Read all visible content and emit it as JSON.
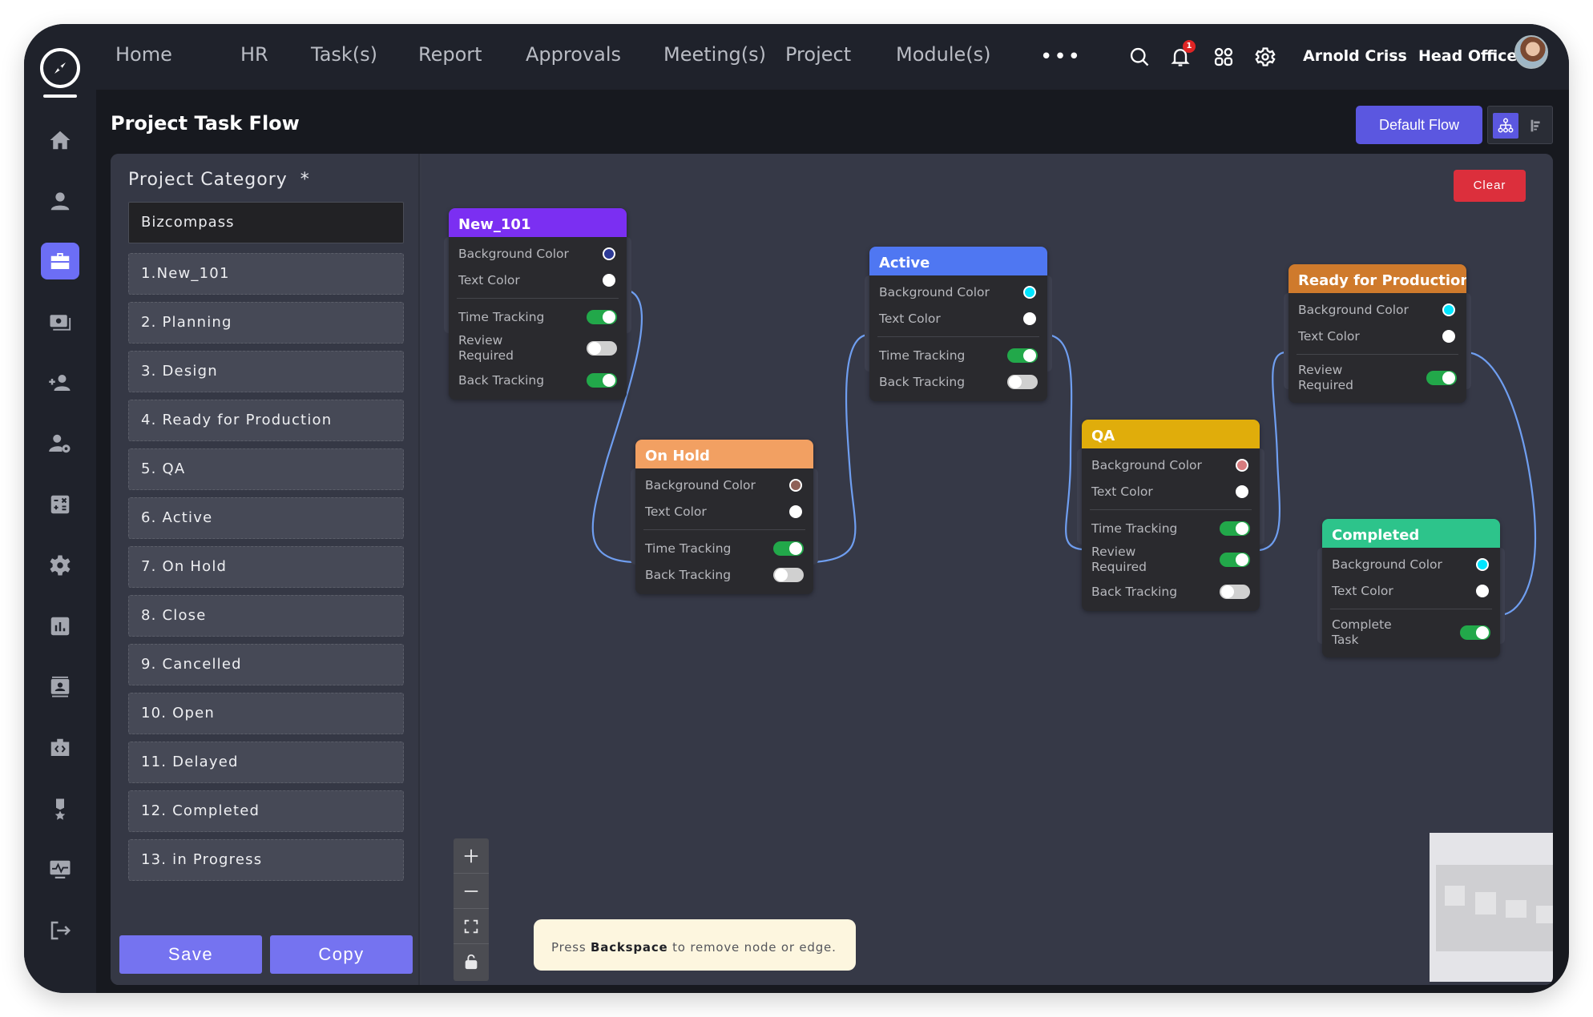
{
  "topnav": {
    "items": [
      "Home",
      "HR",
      "Task(s)",
      "Report",
      "Approvals",
      "Meeting(s)",
      "Project",
      "Module(s)"
    ],
    "more_icon": "more-horizontal-icon",
    "notification_count": "1",
    "user_name": "Arnold Criss",
    "branch": "Head Office",
    "icons": [
      "search-icon",
      "bell-icon",
      "apps-grid-icon",
      "gear-icon"
    ]
  },
  "sidebar": {
    "logo_icon": "compass-icon",
    "items": [
      {
        "icon": "home-icon",
        "active": false
      },
      {
        "icon": "user-icon",
        "active": false
      },
      {
        "icon": "briefcase-icon",
        "active": true
      },
      {
        "icon": "money-icon",
        "active": false
      },
      {
        "icon": "add-user-icon",
        "active": false
      },
      {
        "icon": "user-settings-icon",
        "active": false
      },
      {
        "icon": "calculator-icon",
        "active": false
      },
      {
        "icon": "gear-icon",
        "active": false
      },
      {
        "icon": "bar-chart-icon",
        "active": false
      },
      {
        "icon": "contact-card-icon",
        "active": false
      },
      {
        "icon": "code-briefcase-icon",
        "active": false
      },
      {
        "icon": "medal-icon",
        "active": false
      },
      {
        "icon": "monitor-pulse-icon",
        "active": false
      },
      {
        "icon": "logout-icon",
        "active": false
      }
    ]
  },
  "page": {
    "title": "Project Task Flow",
    "default_flow_label": "Default Flow",
    "view_toggle": [
      "flow-view-icon",
      "list-view-icon"
    ]
  },
  "category_panel": {
    "label": "Project Category",
    "required_mark": "*",
    "selected": "Bizcompass",
    "items": [
      "1.New_101",
      "2. Planning",
      "3. Design",
      "4. Ready for Production",
      "5. QA",
      "6. Active",
      "7. On Hold",
      "8. Close",
      "9. Cancelled",
      "10. Open",
      "11. Delayed",
      "12. Completed",
      "13. in Progress"
    ],
    "save_label": "Save",
    "copy_label": "Copy"
  },
  "canvas": {
    "clear_label": "Clear",
    "hint": {
      "prefix": "Press ",
      "key": "Backspace",
      "suffix": " to remove node or edge."
    },
    "controls": [
      "zoom-in-icon",
      "zoom-out-icon",
      "fit-view-icon",
      "lock-icon"
    ],
    "nodes": [
      {
        "id": "new101",
        "title": "New_101",
        "header_color": "#7b2ff2",
        "bg_color_swatch": "#2d3a96",
        "text_color_swatch": "#ffffff",
        "bg_label": "Background Color",
        "text_label": "Text Color",
        "toggles": [
          {
            "label": "Time Tracking",
            "on": true
          },
          {
            "label": "Review Required",
            "on": false
          },
          {
            "label": "Back Tracking",
            "on": true
          }
        ]
      },
      {
        "id": "onhold",
        "title": "On Hold",
        "header_color": "#f2a062",
        "bg_color_swatch": "#8f6158",
        "text_color_swatch": "#ffffff",
        "bg_label": "Background Color",
        "text_label": "Text Color",
        "toggles": [
          {
            "label": "Time Tracking",
            "on": true
          },
          {
            "label": "Back Tracking",
            "on": false
          }
        ]
      },
      {
        "id": "active",
        "title": "Active",
        "header_color": "#4f77f2",
        "bg_color_swatch": "#00e5ff",
        "text_color_swatch": "#ffffff",
        "bg_label": "Background Color",
        "text_label": "Text Color",
        "toggles": [
          {
            "label": "Time Tracking",
            "on": true
          },
          {
            "label": "Back Tracking",
            "on": false
          }
        ]
      },
      {
        "id": "qa",
        "title": "QA",
        "header_color": "#e0ad0b",
        "bg_color_swatch": "#d77b7e",
        "text_color_swatch": "#ffffff",
        "bg_label": "Background Color",
        "text_label": "Text Color",
        "toggles": [
          {
            "label": "Time Tracking",
            "on": true
          },
          {
            "label": "Review Required",
            "on": true
          },
          {
            "label": "Back Tracking",
            "on": false
          }
        ]
      },
      {
        "id": "ready",
        "title": "Ready for Production",
        "header_color": "#cf7a2c",
        "bg_color_swatch": "#00e5ff",
        "text_color_swatch": "#ffffff",
        "bg_label": "Background Color",
        "text_label": "Text Color",
        "toggles": [
          {
            "label": "Review Required",
            "on": true
          }
        ]
      },
      {
        "id": "completed",
        "title": "Completed",
        "header_color": "#2dc48b",
        "bg_color_swatch": "#00e5ff",
        "text_color_swatch": "#ffffff",
        "bg_label": "Background Color",
        "text_label": "Text Color",
        "toggles": [
          {
            "label": "Complete Task",
            "on": true
          }
        ]
      }
    ],
    "edges": [
      {
        "from": "New_101",
        "to": "On Hold"
      },
      {
        "from": "On Hold",
        "to": "Active"
      },
      {
        "from": "Active",
        "to": "QA"
      },
      {
        "from": "QA",
        "to": "Ready for Production"
      },
      {
        "from": "Ready for Production",
        "to": "Completed"
      }
    ]
  },
  "colors": {
    "accent": "#5b57e0",
    "button": "#7573f0",
    "danger": "#dc2f3c",
    "edge": "#6f9ef0",
    "toggle_on": "#22a84a"
  }
}
